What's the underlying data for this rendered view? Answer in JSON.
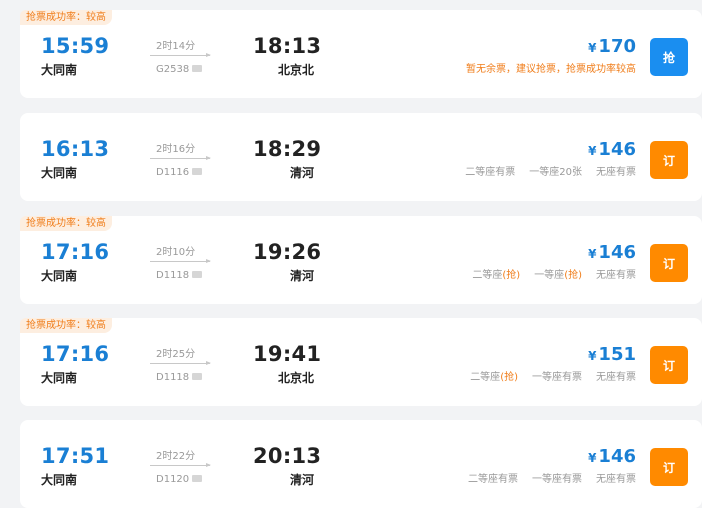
{
  "trains": [
    {
      "tag": "抢票成功率：较高",
      "dep_time": "15:59",
      "dep_station": "大同南",
      "duration": "2时14分",
      "train_no": "G2538",
      "arr_time": "18:13",
      "arr_station": "北京北",
      "price": "170",
      "seats": [
        {
          "text": "暂无余票，建议抢票，抢票成功率较高",
          "warn": true
        }
      ],
      "button": "抢",
      "button_color": "#1a8ef0"
    },
    {
      "tag": "",
      "dep_time": "16:13",
      "dep_station": "大同南",
      "duration": "2时16分",
      "train_no": "D1116",
      "arr_time": "18:29",
      "arr_station": "清河",
      "price": "146",
      "seats": [
        {
          "text": "二等座有票"
        },
        {
          "text": "一等座20张"
        },
        {
          "text": "无座有票"
        }
      ],
      "button": "订",
      "button_color": "#ff8a00"
    },
    {
      "tag": "抢票成功率：较高",
      "dep_time": "17:16",
      "dep_station": "大同南",
      "duration": "2时10分",
      "train_no": "D1118",
      "arr_time": "19:26",
      "arr_station": "清河",
      "price": "146",
      "seats": [
        {
          "text": "二等座",
          "grab": "(抢)"
        },
        {
          "text": "一等座",
          "grab": "(抢)"
        },
        {
          "text": "无座有票"
        }
      ],
      "button": "订",
      "button_color": "#ff8a00"
    },
    {
      "tag": "抢票成功率：较高",
      "dep_time": "17:16",
      "dep_station": "大同南",
      "duration": "2时25分",
      "train_no": "D1118",
      "arr_time": "19:41",
      "arr_station": "北京北",
      "price": "151",
      "seats": [
        {
          "text": "二等座",
          "grab": "(抢)"
        },
        {
          "text": "一等座有票"
        },
        {
          "text": "无座有票"
        }
      ],
      "button": "订",
      "button_color": "#ff8a00"
    },
    {
      "tag": "",
      "dep_time": "17:51",
      "dep_station": "大同南",
      "duration": "2时22分",
      "train_no": "D1120",
      "arr_time": "20:13",
      "arr_station": "清河",
      "price": "146",
      "seats": [
        {
          "text": "二等座有票"
        },
        {
          "text": "一等座有票"
        },
        {
          "text": "无座有票"
        }
      ],
      "button": "订",
      "button_color": "#ff8a00"
    }
  ],
  "currency_symbol": "¥",
  "colors": {
    "accent_blue": "#1a7fd4",
    "accent_orange": "#f07d1a",
    "card_bg": "#ffffff",
    "page_bg": "#f2f3f5"
  }
}
